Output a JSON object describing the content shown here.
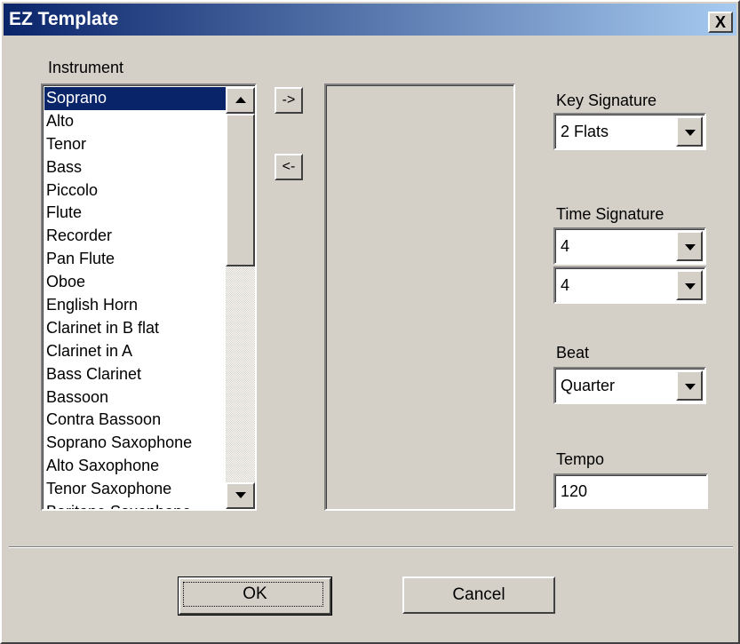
{
  "window": {
    "title": "EZ Template",
    "close_label": "X"
  },
  "instrument": {
    "label": "Instrument",
    "items": [
      "Soprano",
      "Alto",
      "Tenor",
      "Bass",
      "Piccolo",
      "Flute",
      "Recorder",
      "Pan Flute",
      "Oboe",
      "English Horn",
      "Clarinet in B flat",
      "Clarinet in A",
      "Bass Clarinet",
      "Bassoon",
      "Contra Bassoon",
      "Soprano Saxophone",
      "Alto Saxophone",
      "Tenor Saxophone",
      "Baritone Saxophone"
    ],
    "selected": "Soprano"
  },
  "move_buttons": {
    "add": "->",
    "remove": "<-"
  },
  "key_signature": {
    "label": "Key Signature",
    "value": "2 Flats"
  },
  "time_signature": {
    "label": "Time Signature",
    "numerator": "4",
    "denominator": "4"
  },
  "beat": {
    "label": "Beat",
    "value": "Quarter"
  },
  "tempo": {
    "label": "Tempo",
    "value": "120"
  },
  "buttons": {
    "ok": "OK",
    "cancel": "Cancel"
  },
  "colors": {
    "title_start": "#0a246a",
    "title_end": "#a6caf0",
    "selection": "#0a246a",
    "face": "#d4d0c8"
  },
  "icons": {
    "scroll_up": "up-arrow-icon",
    "scroll_down": "down-arrow-icon",
    "dropdown": "dropdown-arrow-icon"
  }
}
